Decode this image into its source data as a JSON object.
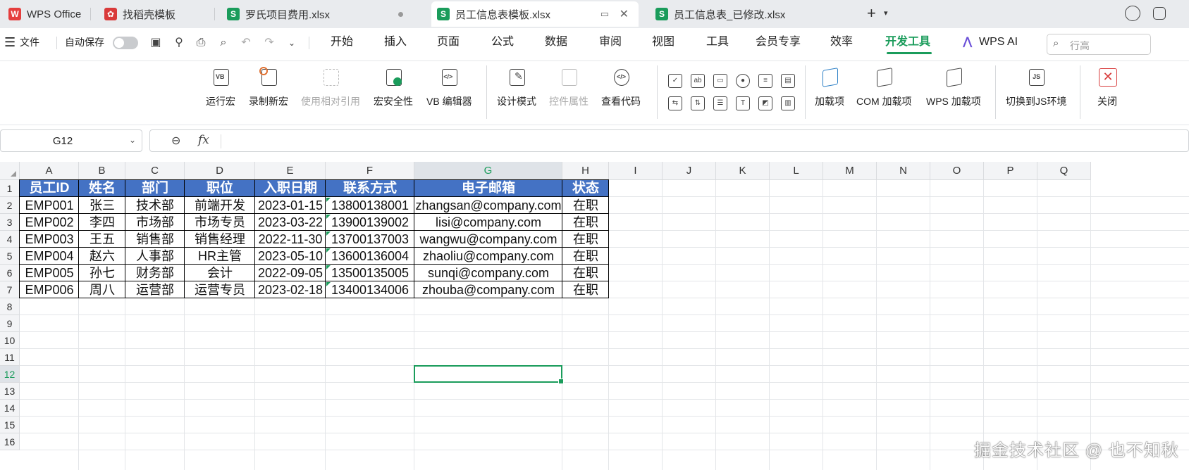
{
  "tabs": [
    {
      "label": "WPS Office",
      "icon": "wps-logo-icon"
    },
    {
      "label": "找稻壳模板",
      "icon": "daoke-icon"
    },
    {
      "label": "罗氏项目费用.xlsx",
      "icon": "sheet-icon"
    },
    {
      "label": "员工信息表模板.xlsx",
      "icon": "sheet-icon",
      "active": true
    },
    {
      "label": "员工信息表_已修改.xlsx",
      "icon": "sheet-icon"
    }
  ],
  "tab_icon_letter": "S",
  "menubar": {
    "file": "文件",
    "autosave": "自动保存",
    "items": [
      "开始",
      "插入",
      "页面",
      "公式",
      "数据",
      "审阅",
      "视图",
      "工具",
      "会员专享",
      "效率",
      "开发工具",
      "WPS AI"
    ],
    "active": "开发工具",
    "search_placeholder": "行高"
  },
  "ribbon": {
    "macro_group": [
      "运行宏",
      "录制新宏",
      "使用相对引用",
      "宏安全性",
      "VB 编辑器"
    ],
    "design_group": [
      "设计模式",
      "控件属性",
      "查看代码"
    ],
    "addin_group": [
      "加载项",
      "COM 加载项",
      "WPS 加载项"
    ],
    "js_label": "切换到JS环境",
    "close_label": "关闭",
    "disabled": [
      "使用相对引用",
      "控件属性"
    ]
  },
  "formula_bar": {
    "name_box": "G12",
    "formula": ""
  },
  "sheet": {
    "columns": [
      "A",
      "B",
      "C",
      "D",
      "E",
      "F",
      "G",
      "H",
      "I",
      "J",
      "K",
      "L",
      "M",
      "N",
      "O",
      "P",
      "Q"
    ],
    "rows": [
      "1",
      "2",
      "3",
      "4",
      "5",
      "6",
      "7",
      "8",
      "9",
      "10",
      "11",
      "12",
      "13",
      "14",
      "15",
      "16"
    ],
    "selected_cell": "G12",
    "header_fill": "#4472c4",
    "headers": [
      "员工ID",
      "姓名",
      "部门",
      "职位",
      "入职日期",
      "联系方式",
      "电子邮箱",
      "状态"
    ],
    "data": [
      [
        "EMP001",
        "张三",
        "技术部",
        "前端开发",
        "2023-01-15",
        "13800138001",
        "zhangsan@company.com",
        "在职"
      ],
      [
        "EMP002",
        "李四",
        "市场部",
        "市场专员",
        "2023-03-22",
        "13900139002",
        "lisi@company.com",
        "在职"
      ],
      [
        "EMP003",
        "王五",
        "销售部",
        "销售经理",
        "2022-11-30",
        "13700137003",
        "wangwu@company.com",
        "在职"
      ],
      [
        "EMP004",
        "赵六",
        "人事部",
        "HR主管",
        "2023-05-10",
        "13600136004",
        "zhaoliu@company.com",
        "在职"
      ],
      [
        "EMP005",
        "孙七",
        "财务部",
        "会计",
        "2022-09-05",
        "13500135005",
        "sunqi@company.com",
        "在职"
      ],
      [
        "EMP006",
        "周八",
        "运营部",
        "运营专员",
        "2023-02-18",
        "13400134006",
        "zhouba@company.com",
        "在职"
      ]
    ]
  },
  "watermark": "掘金技术社区 @ 也不知秋",
  "colors": {
    "accent": "#1a9c5b",
    "header_blue": "#4472c4"
  }
}
